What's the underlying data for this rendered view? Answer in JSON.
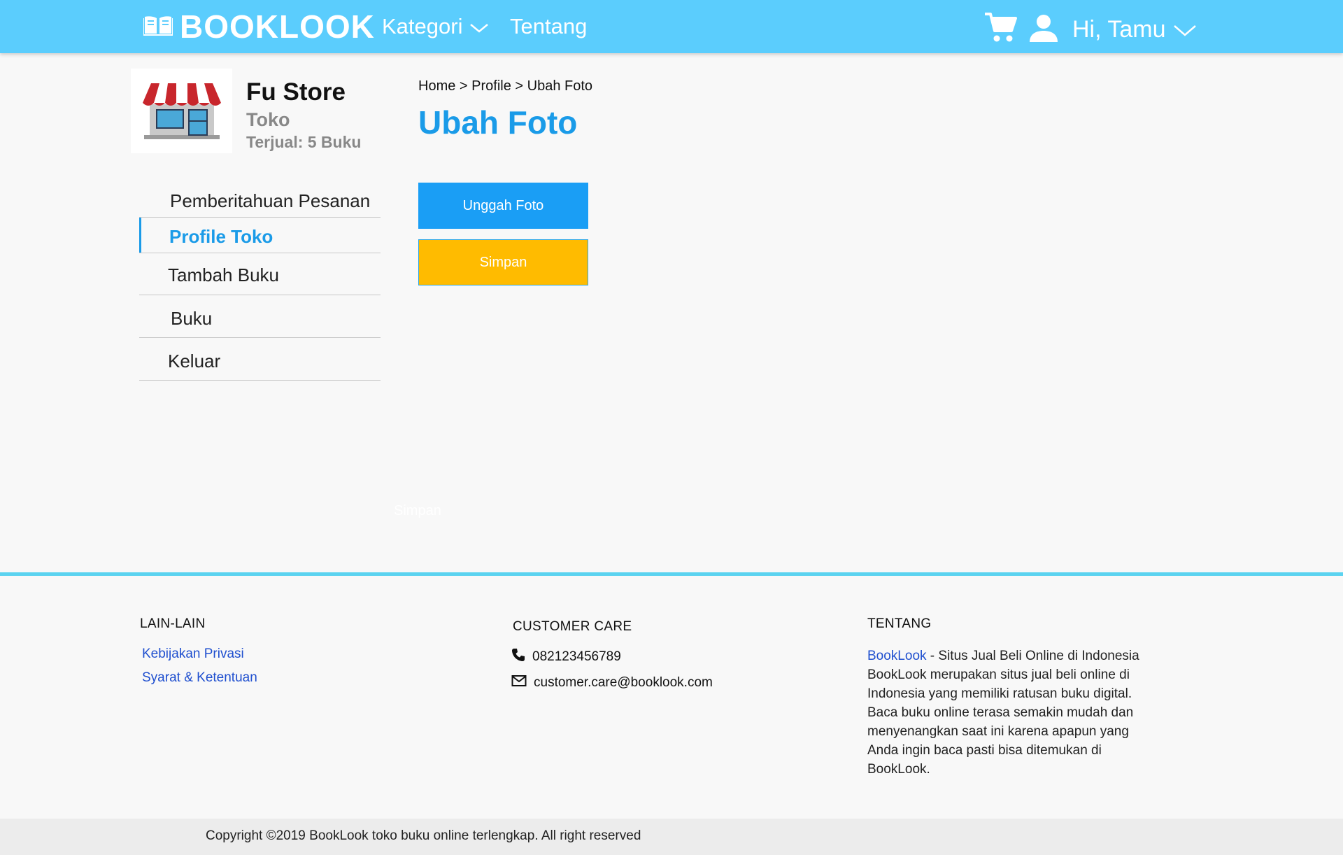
{
  "header": {
    "logo_text": "BOOKLOOK",
    "nav": {
      "kategori": "Kategori",
      "tentang": "Tentang"
    },
    "greeting": "Hi, Tamu",
    "icons": [
      "book-icon",
      "chevron-down-icon",
      "cart-icon",
      "user-icon"
    ]
  },
  "store": {
    "name": "Fu Store",
    "type": "Toko",
    "sold": "Terjual: 5 Buku"
  },
  "sidebar": {
    "items": [
      {
        "label": "Pemberitahuan Pesanan",
        "active": false
      },
      {
        "label": "Profile Toko",
        "active": true
      },
      {
        "label": "Tambah Buku",
        "active": false
      },
      {
        "label": "Buku",
        "active": false
      },
      {
        "label": "Keluar",
        "active": false
      }
    ]
  },
  "breadcrumb": {
    "home": "Home",
    "sep1": " > ",
    "profile": "Profile",
    "sep2": " > ",
    "current": "Ubah Foto"
  },
  "main": {
    "title": "Ubah Foto",
    "upload_label": "Unggah Foto",
    "save_label": "Simpan",
    "ghost_label": "Simpan"
  },
  "footer": {
    "lain": {
      "heading": "LAIN-LAIN",
      "links": [
        "Kebijakan Privasi",
        "Syarat & Ketentuan"
      ]
    },
    "care": {
      "heading": "CUSTOMER CARE",
      "phone": "082123456789",
      "email": "customer.care@booklook.com"
    },
    "tentang": {
      "heading": "TENTANG",
      "brand": "BookLook",
      "text": " - Situs Jual Beli Online di Indonesia BookLook merupakan situs jual beli online di Indonesia yang memiliki ratusan buku digital. Baca buku online terasa semakin mudah dan menyenangkan saat ini karena apapun yang Anda ingin baca pasti bisa ditemukan di BookLook."
    },
    "copyright": "Copyright ©2019 BookLook toko buku online terlengkap. All right reserved"
  },
  "colors": {
    "header": "#5bcdfd",
    "accent": "#1a9be8",
    "upload_button": "#1a9ef5",
    "save_button": "#ffbb00",
    "link": "#1f4fcf"
  }
}
